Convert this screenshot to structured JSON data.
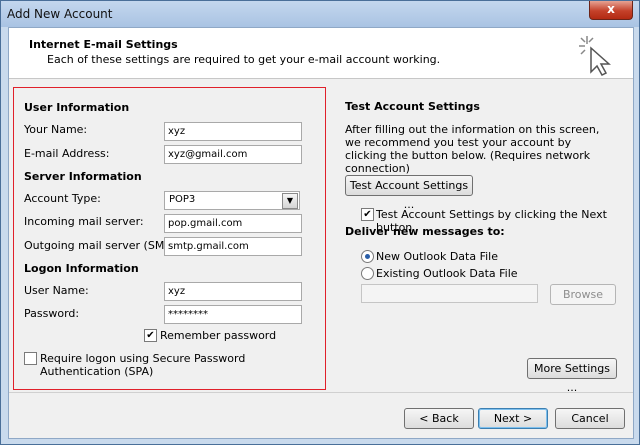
{
  "window": {
    "title": "Add New Account",
    "close_symbol": "x"
  },
  "header": {
    "title": "Internet E-mail Settings",
    "subtitle": "Each of these settings are required to get your e-mail account working.",
    "icon": "cursor-sparkle-icon"
  },
  "user_info": {
    "heading": "User Information",
    "name_label": "Your Name:",
    "name_value": "xyz",
    "email_label": "E-mail Address:",
    "email_value": "xyz@gmail.com"
  },
  "server_info": {
    "heading": "Server Information",
    "account_type_label": "Account Type:",
    "account_type_value": "POP3",
    "incoming_label": "Incoming mail server:",
    "incoming_value": "pop.gmail.com",
    "outgoing_label": "Outgoing mail server (SMTP):",
    "outgoing_value": "smtp.gmail.com"
  },
  "logon_info": {
    "heading": "Logon Information",
    "username_label": "User Name:",
    "username_value": "xyz",
    "password_label": "Password:",
    "password_value": "********",
    "remember_label": "Remember password",
    "remember_checked": "✔",
    "spa_label": "Require logon using Secure Password Authentication (SPA)"
  },
  "test_settings": {
    "heading": "Test Account Settings",
    "description": "After filling out the information on this screen, we recommend you test your account by clicking the button below. (Requires network connection)",
    "button_label": "Test Account Settings ...",
    "auto_test_label": "Test Account Settings by clicking the Next button",
    "auto_test_checked": "✔"
  },
  "deliver": {
    "heading": "Deliver new messages to:",
    "option_new": "New Outlook Data File",
    "option_existing": "Existing Outlook Data File",
    "browse_label": "Browse"
  },
  "buttons": {
    "more_settings": "More Settings ...",
    "back": "< Back",
    "next": "Next >",
    "cancel": "Cancel"
  }
}
